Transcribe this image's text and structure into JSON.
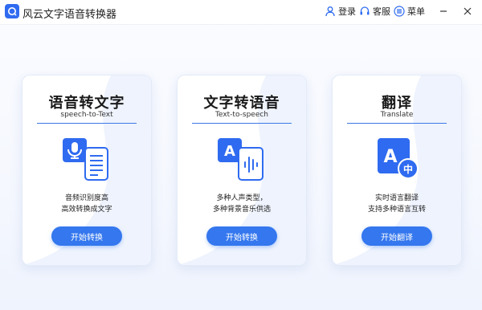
{
  "app": {
    "title": "风云文字语音转换器"
  },
  "toolbar": {
    "login": "登录",
    "service": "客服",
    "menu": "菜单"
  },
  "cards": [
    {
      "title": "语音转文字",
      "subtitle": "speech-to-Text",
      "desc_line1": "音频识别度高",
      "desc_line2": "高效转换成文字",
      "button": "开始转换",
      "icon": "speech-to-text-icon"
    },
    {
      "title": "文字转语音",
      "subtitle": "Text-to-speech",
      "desc_line1": "多种人声类型，",
      "desc_line2": "多种背景音乐供选",
      "button": "开始转换",
      "icon": "text-to-speech-icon"
    },
    {
      "title": "翻译",
      "subtitle": "Translate",
      "desc_line1": "实时语言翻译",
      "desc_line2": "支持多种语言互转",
      "button": "开始翻译",
      "icon": "translate-icon"
    }
  ],
  "colors": {
    "accent": "#3477ee",
    "icon_blue": "#2f6bf0"
  }
}
